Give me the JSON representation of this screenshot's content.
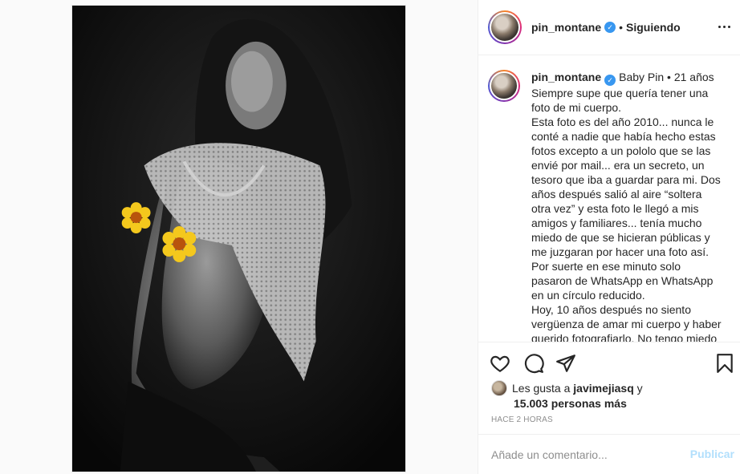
{
  "post": {
    "username": "pin_montane",
    "follow_status": "Siguiendo",
    "separator": "•"
  },
  "caption": {
    "username": "pin_montane",
    "text": "Baby Pin • 21 años\nSiempre supe que quería tener una foto de mi cuerpo.\nEsta foto es del año 2010... nunca le conté a nadie que había hecho estas fotos excepto a un pololo que se las envié por mail... era un secreto, un tesoro que iba a guardar para mi. Dos años después salió al aire “soltera otra vez” y esta foto le llegó a mis amigos y familiares... tenía mucho miedo de que se hicieran públicas y me juzgaran por hacer una foto así. Por suerte en ese minuto solo pasaron de WhatsApp en WhatsApp en un círculo reducido.\nHoy, 10 años después no siento vergüenza de amar mi cuerpo y haber querido fotografiarlo. No tengo miedo"
  },
  "likes": {
    "prefix": "Les gusta a",
    "user": "javimejiasq",
    "joiner": "y",
    "count": "15.003 personas más"
  },
  "timestamp": "HACE 2 HORAS",
  "comment": {
    "placeholder": "Añade un comentario...",
    "publish_label": "Publicar"
  },
  "icons": {
    "verified": "verified-badge-icon",
    "more": "more-options-icon",
    "like": "heart-icon",
    "comment": "comment-icon",
    "share": "share-icon",
    "save": "bookmark-icon"
  },
  "colors": {
    "verified": "#3897f0",
    "publish_disabled": "#b2dffc",
    "muted": "#8e8e8e"
  }
}
